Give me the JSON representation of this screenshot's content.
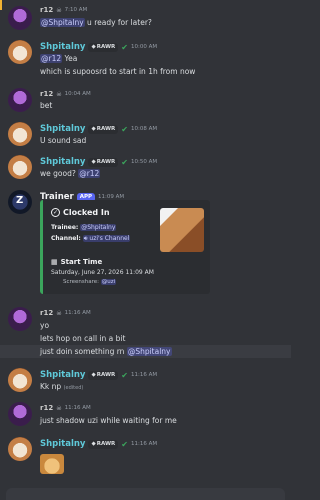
{
  "messages": [
    {
      "author": "r12",
      "time": "7:10 AM",
      "lines": [
        {
          "pre": "",
          "mention": "@Shpitalny",
          "post": " u ready for later?"
        }
      ]
    },
    {
      "author": "Shpitalny",
      "badge": "RAWR",
      "time": "10:00 AM",
      "lines": [
        {
          "pre": "",
          "mention": "@r12",
          "post": " Yea"
        },
        {
          "pre": "which is supoosrd to start in 1h from now",
          "mention": "",
          "post": ""
        }
      ]
    },
    {
      "author": "r12",
      "time": "10:04 AM",
      "lines": [
        {
          "pre": "bet",
          "mention": "",
          "post": ""
        }
      ]
    },
    {
      "author": "Shpitalny",
      "badge": "RAWR",
      "time": "10:08 AM",
      "lines": [
        {
          "pre": "U sound sad",
          "mention": "",
          "post": ""
        }
      ]
    },
    {
      "author": "Shpitalny",
      "badge": "RAWR",
      "time": "10:50 AM",
      "lines": [
        {
          "pre": "we good? ",
          "mention": "@r12",
          "post": ""
        }
      ]
    },
    {
      "author": "Trainer",
      "badge": "APP",
      "time": "11:09 AM"
    },
    {
      "author": "r12",
      "time": "11:16 AM",
      "lines": [
        {
          "pre": "yo",
          "mention": "",
          "post": ""
        },
        {
          "pre": "lets hop on call in a bit",
          "mention": "",
          "post": ""
        },
        {
          "pre": "just doin something rn ",
          "mention": "@Shpitalny",
          "post": ""
        }
      ]
    },
    {
      "author": "Shpitalny",
      "badge": "RAWR",
      "time": "11:16 AM",
      "lines": [
        {
          "pre": "Kk np",
          "mention": "",
          "post": ""
        }
      ],
      "edited": "(edited)"
    },
    {
      "author": "r12",
      "time": "11:16 AM",
      "lines": [
        {
          "pre": "just shadow uzi while waiting for me",
          "mention": "",
          "post": ""
        }
      ]
    },
    {
      "author": "Shpitalny",
      "badge": "RAWR",
      "time": "11:16 AM"
    }
  ],
  "embed": {
    "title": "Clocked In",
    "trainee_label": "Trainee:",
    "trainee_value": "@Shpitalny",
    "channel_label": "Channel:",
    "channel_value": "uzi's Channel",
    "start_title": "Start Time",
    "start_value": "Saturday, June 27, 2026 11:09 AM",
    "share_label": "Screenshare:",
    "share_value": "@uzi"
  },
  "colors": {
    "accent": "#5865f2",
    "embed_bar": "#3ba55c",
    "shpitalny": "#5fc9d9"
  }
}
